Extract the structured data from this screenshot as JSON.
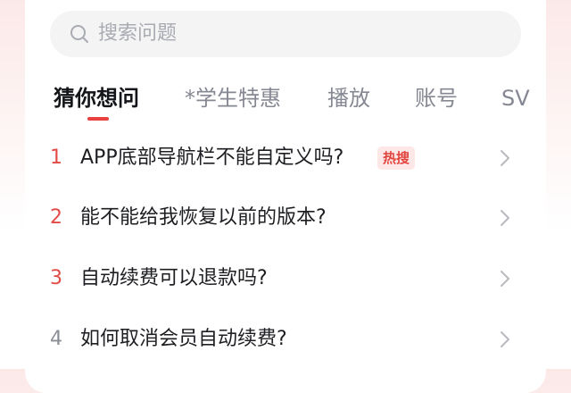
{
  "search": {
    "placeholder": "搜索问题",
    "icon": "search-icon"
  },
  "tabs": [
    {
      "label": "猜你想问",
      "active": true
    },
    {
      "label": "*学生特惠",
      "active": false
    },
    {
      "label": "播放",
      "active": false
    },
    {
      "label": "账号",
      "active": false
    },
    {
      "label": "SV",
      "active": false
    }
  ],
  "questions": [
    {
      "num": "1",
      "text": "APP底部导航栏不能自定义吗?",
      "badge": "热搜"
    },
    {
      "num": "2",
      "text": "能不能给我恢复以前的版本?",
      "badge": ""
    },
    {
      "num": "3",
      "text": "自动续费可以退款吗?",
      "badge": ""
    },
    {
      "num": "4",
      "text": "如何取消会员自动续费?",
      "badge": ""
    }
  ],
  "colors": {
    "accent": "#e8413f",
    "rank_top": "#e14a45",
    "rank_other": "#8b8e96"
  }
}
